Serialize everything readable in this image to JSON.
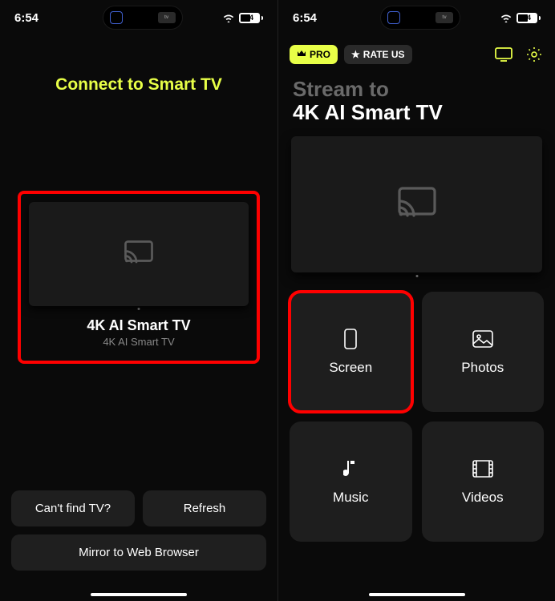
{
  "statusBar": {
    "time": "6:54",
    "batteryPercent": "54"
  },
  "screen1": {
    "title": "Connect to Smart TV",
    "device": {
      "name": "4K AI Smart TV",
      "subname": "4K AI Smart TV"
    },
    "buttons": {
      "cantFind": "Can't find TV?",
      "refresh": "Refresh",
      "mirror": "Mirror to Web Browser"
    }
  },
  "screen2": {
    "badges": {
      "pro": "PRO",
      "rate": "RATE US"
    },
    "streamLabel": "Stream to",
    "deviceName": "4K AI Smart TV",
    "tiles": {
      "screen": "Screen",
      "photos": "Photos",
      "music": "Music",
      "videos": "Videos"
    }
  }
}
